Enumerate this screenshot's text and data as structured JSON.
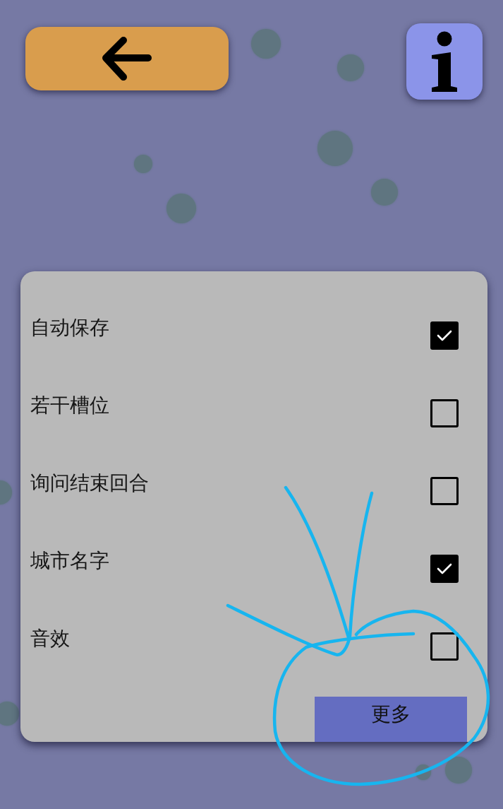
{
  "settings_panel": {
    "options": [
      {
        "label": "自动保存",
        "checked": true
      },
      {
        "label": "若干槽位",
        "checked": false
      },
      {
        "label": "询问结束回合",
        "checked": false
      },
      {
        "label": "城市名字",
        "checked": true
      },
      {
        "label": "音效",
        "checked": false
      }
    ],
    "more_button": {
      "label": "更多"
    }
  }
}
